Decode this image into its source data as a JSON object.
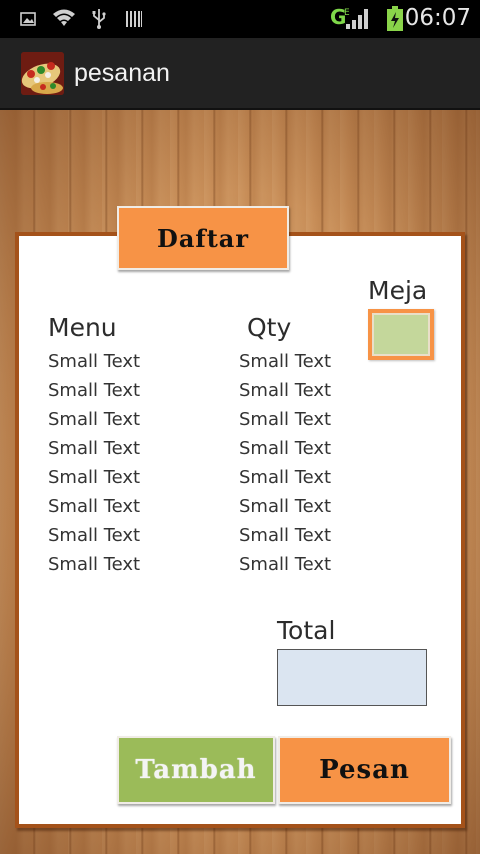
{
  "status_bar": {
    "time": "06:07",
    "network_label": "G",
    "icons": [
      "picture-icon",
      "wifi-icon",
      "usb-icon",
      "barcode-icon",
      "signal-icon",
      "battery-charging-icon"
    ]
  },
  "action_bar": {
    "title": "pesanan",
    "app_icon": "food-app-icon"
  },
  "main": {
    "daftar_button": "Daftar",
    "meja_label": "Meja",
    "meja_value": "",
    "menu_header": "Menu",
    "qty_header": "Qty",
    "menu_items": [
      "Small Text",
      "Small Text",
      "Small Text",
      "Small Text",
      "Small Text",
      "Small Text",
      "Small Text",
      "Small Text"
    ],
    "qty_items": [
      "Small Text",
      "Small Text",
      "Small Text",
      "Small Text",
      "Small Text",
      "Small Text",
      "Small Text",
      "Small Text"
    ],
    "total_label": "Total",
    "total_value": "",
    "tambah_button": "Tambah",
    "pesan_button": "Pesan"
  },
  "colors": {
    "orange": "#f79346",
    "green": "#9bbb59",
    "meja_fill": "#c4d79b",
    "total_fill": "#dbe5f1",
    "card_border": "#a4521a"
  }
}
